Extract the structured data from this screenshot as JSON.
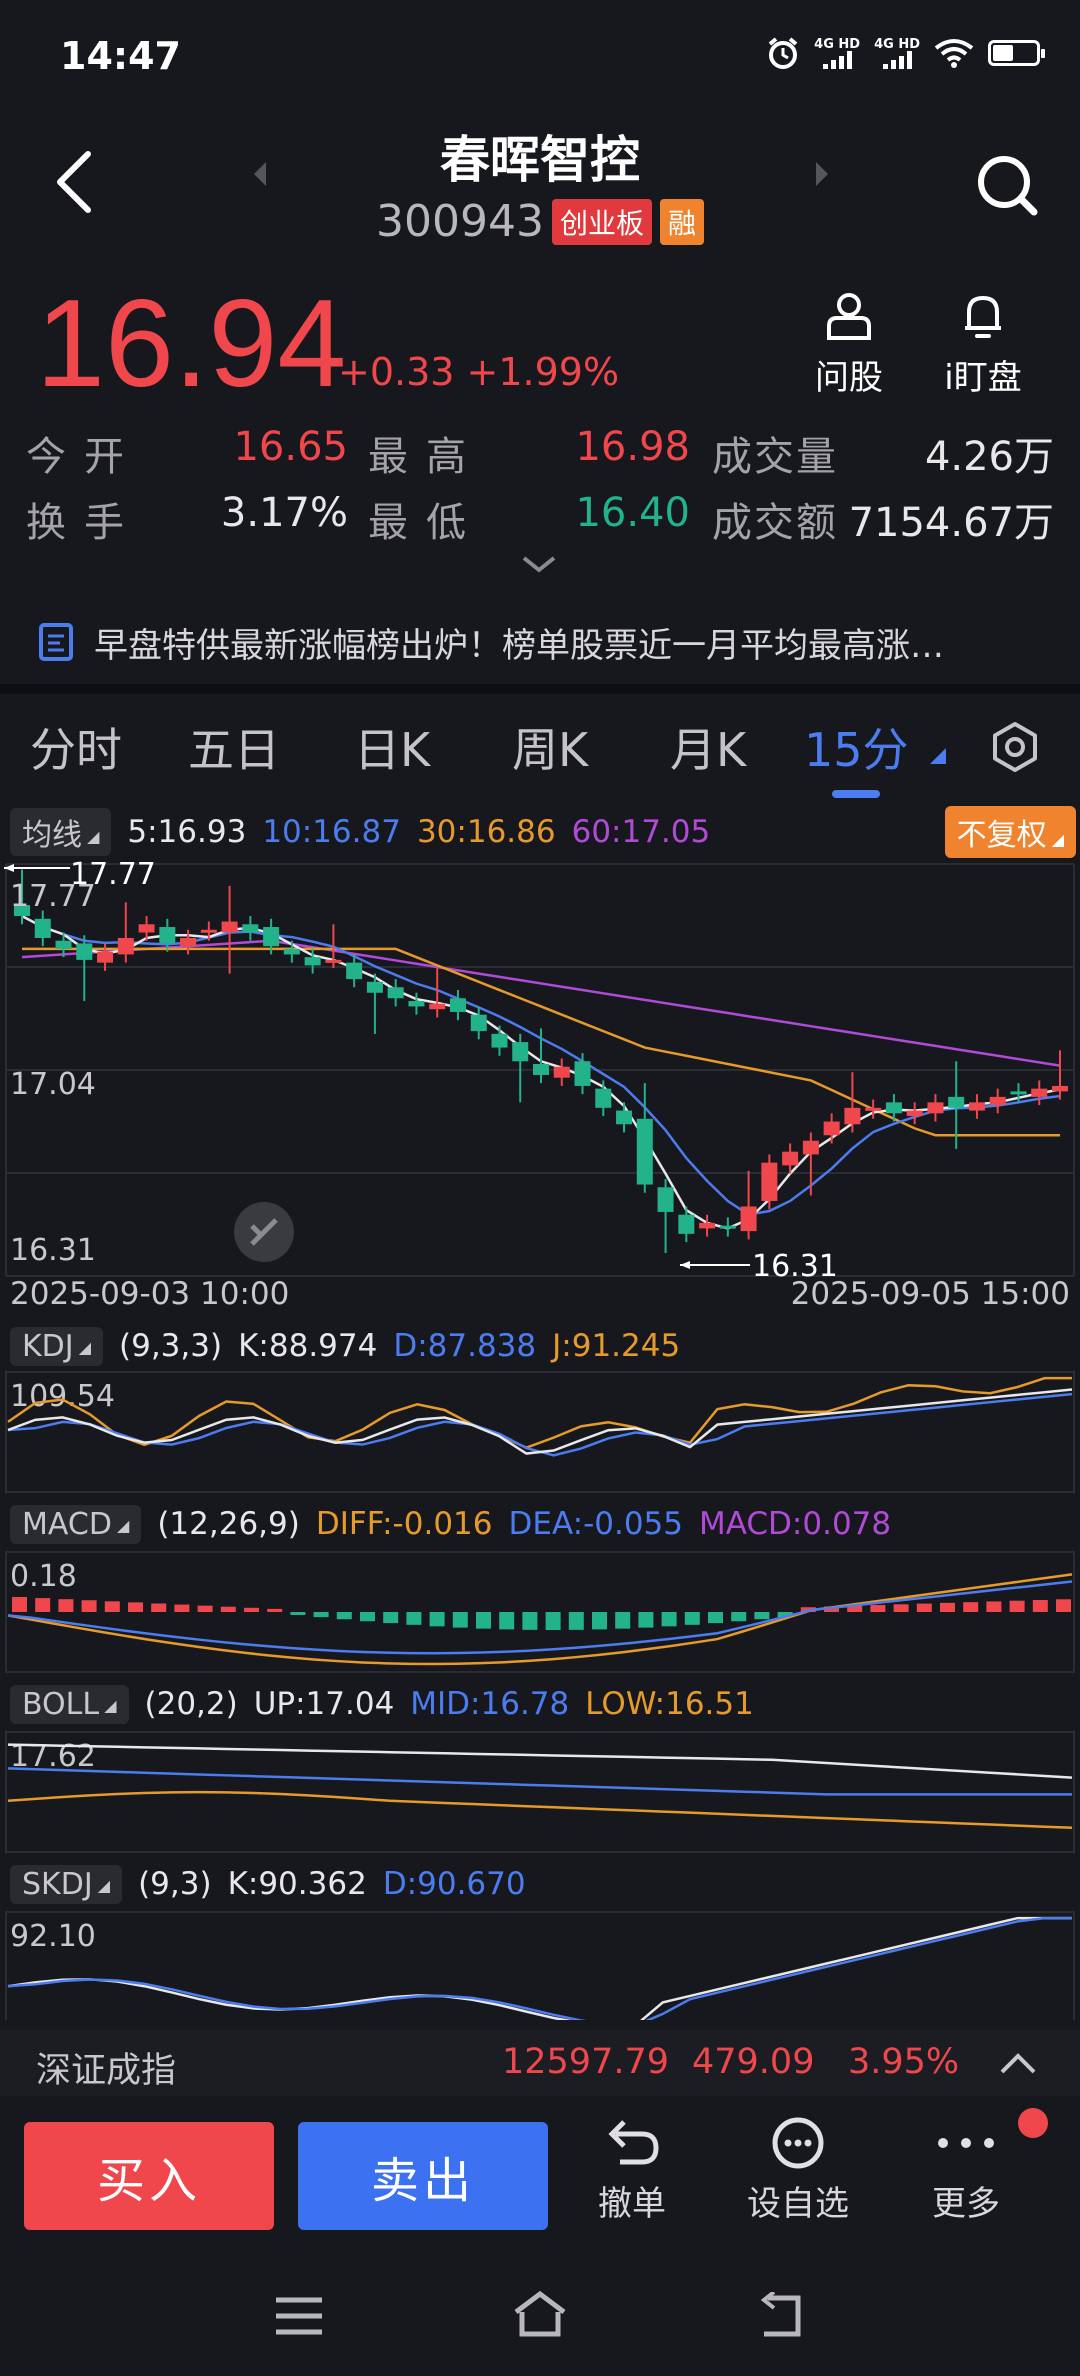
{
  "status_bar": {
    "time": "14:47",
    "sim1": "4G HD",
    "sim2": "4G HD",
    "battery_level": 0.45
  },
  "header": {
    "title": "春晖智控",
    "code": "300943",
    "board_tag": "创业板",
    "margin_tag": "融"
  },
  "quote": {
    "price": "16.94",
    "change": "+0.33 +1.99%",
    "ask_label": "问股",
    "watch_label": "i盯盘",
    "rows": [
      {
        "l1": "今开",
        "v1": "16.65",
        "l2": "最高",
        "v2": "16.98",
        "l3": "成交量",
        "v3": "4.26万"
      },
      {
        "l1": "换手",
        "v1": "3.17%",
        "l2": "最低",
        "v2": "16.40",
        "l3": "成交额",
        "v3": "7154.67万"
      }
    ]
  },
  "news": {
    "text": "早盘特供最新涨幅榜出炉！榜单股票近一月平均最高涨…"
  },
  "tabs": [
    "分时",
    "五日",
    "日K",
    "周K",
    "月K",
    "15分"
  ],
  "active_tab": "15分",
  "ma": {
    "label": "均线",
    "ma5": "5:16.93",
    "ma10": "10:16.87",
    "ma30": "30:16.86",
    "ma60": "60:17.05",
    "adjust": "不复权"
  },
  "main_chart": {
    "y_top": "17.77",
    "y_mid": "17.04",
    "y_bottom": "16.31",
    "max_marker": "17.77",
    "min_marker": "16.31",
    "x_start": "2025-09-03 10:00",
    "x_end": "2025-09-05 15:00"
  },
  "kdj": {
    "label": "KDJ",
    "params": "(9,3,3)",
    "k": "K:88.974",
    "d": "D:87.838",
    "j": "J:91.245",
    "y_top": "109.54"
  },
  "macd": {
    "label": "MACD",
    "params": "(12,26,9)",
    "diff": "DIFF:-0.016",
    "dea": "DEA:-0.055",
    "macd": "MACD:0.078",
    "y_top": "0.18"
  },
  "boll": {
    "label": "BOLL",
    "params": "(20,2)",
    "up": "UP:17.04",
    "mid": "MID:16.78",
    "low": "LOW:16.51",
    "y_top": "17.62"
  },
  "skdj": {
    "label": "SKDJ",
    "params": "(9,3)",
    "k": "K:90.362",
    "d": "D:90.670",
    "y_top": "92.10"
  },
  "index_bar": {
    "name": "深证成指",
    "value": "12597.79",
    "change": "479.09",
    "pct": "3.95%"
  },
  "actions": {
    "buy": "买入",
    "sell": "卖出",
    "cancel": "撤单",
    "favorite": "设自选",
    "more": "更多"
  },
  "colors": {
    "up": "#f0474c",
    "down": "#22b38a",
    "accent": "#4b7cf0",
    "ma5": "#e8e8ea",
    "ma10": "#4b7cf0",
    "ma30": "#e69a2b",
    "ma60": "#b14ad8"
  }
}
